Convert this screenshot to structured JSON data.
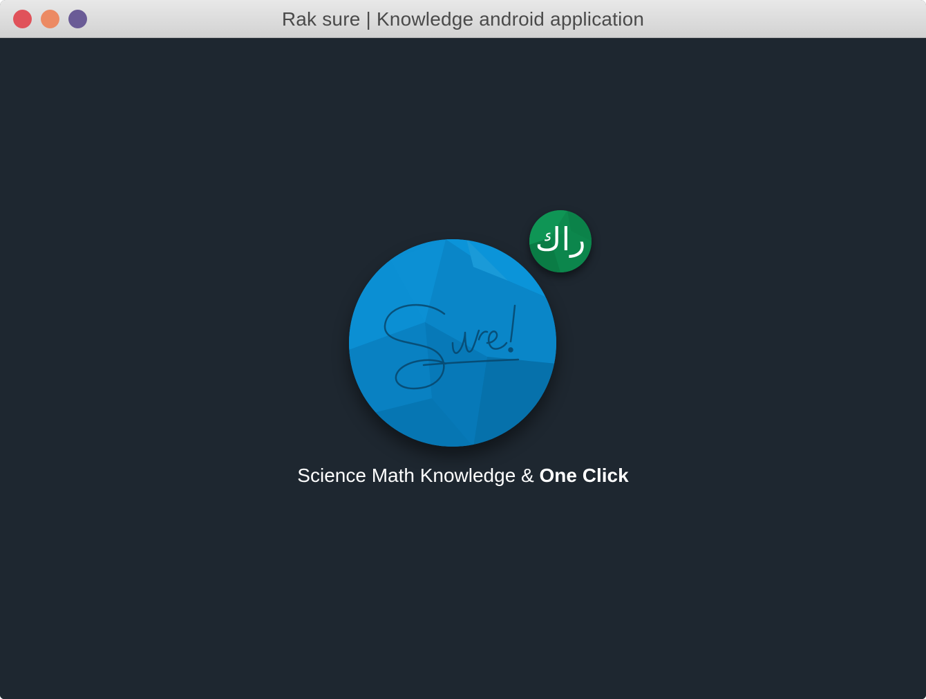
{
  "window": {
    "title": "Rak sure | Knowledge android application"
  },
  "logo": {
    "script_text": "Sure!",
    "colors": {
      "primary": "#0a86c8",
      "light": "#1a9ad8",
      "dark": "#0671ab"
    }
  },
  "badge": {
    "text": "راك",
    "color": "#0d8a4e"
  },
  "tagline": {
    "regular": "Science Math Knowledge & ",
    "bold": "One Click"
  },
  "colors": {
    "background": "#1e2730",
    "traffic_close": "#e0525a",
    "traffic_minimize": "#ec8a63",
    "traffic_maximize": "#6a5b96"
  }
}
